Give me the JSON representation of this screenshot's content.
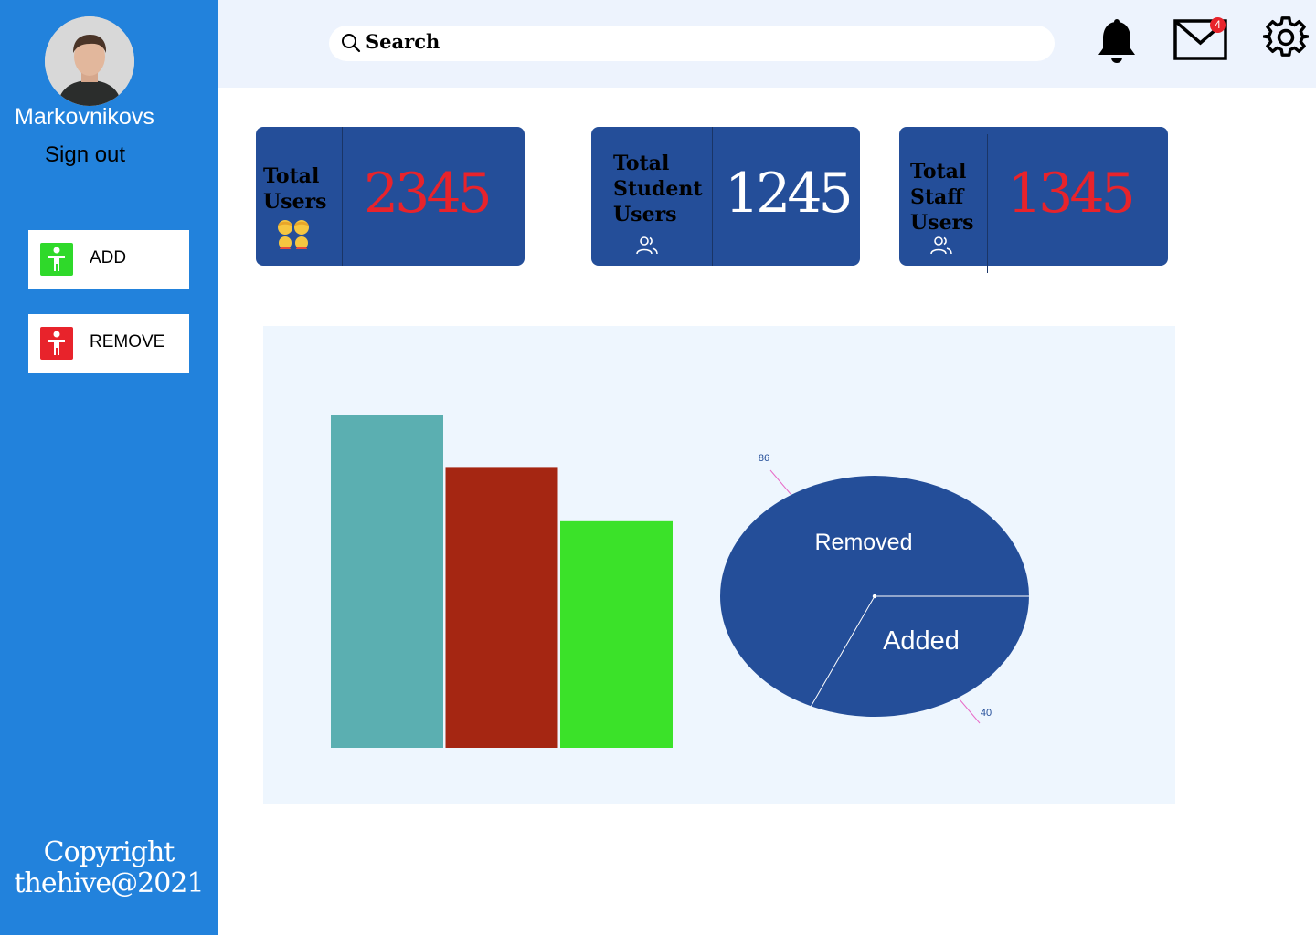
{
  "sidebar": {
    "username": "Markovnikovs",
    "sign_out": "Sign out",
    "add_label": "ADD",
    "remove_label": "REMOVE",
    "copyright_line1": "Copyright",
    "copyright_line2": "thehive@2021"
  },
  "header": {
    "search_text": "Search",
    "mail_badge": "4"
  },
  "cards": [
    {
      "line1": "Total",
      "line2": "Users",
      "line3": "",
      "value": "2345",
      "value_color": "#e8232b",
      "icon": "family-emoji-icon"
    },
    {
      "line1": "Total",
      "line2": "Student",
      "line3": "Users",
      "value": "1245",
      "value_color": "#ffffff",
      "icon": "users-icon"
    },
    {
      "line1": "Total",
      "line2": "Staff",
      "line3": "Users",
      "value": "1345",
      "value_color": "#e8232b",
      "icon": "users-icon"
    }
  ],
  "colors": {
    "sidebar": "#2282dc",
    "card": "#244e99",
    "add_icon_bg": "#2fd92a",
    "remove_icon_bg": "#e8232b"
  },
  "chart_data": [
    {
      "type": "bar",
      "categories": [
        "",
        "",
        ""
      ],
      "values": [
        100,
        84,
        68
      ],
      "colors": [
        "#5bafb1",
        "#a52612",
        "#3be229"
      ],
      "ylim": [
        0,
        100
      ]
    },
    {
      "type": "pie",
      "labels": [
        "Removed",
        "Added"
      ],
      "values": [
        86,
        40
      ],
      "colors": [
        "#244e99",
        "#244e99"
      ],
      "value_labels": [
        "86",
        "40"
      ]
    }
  ]
}
